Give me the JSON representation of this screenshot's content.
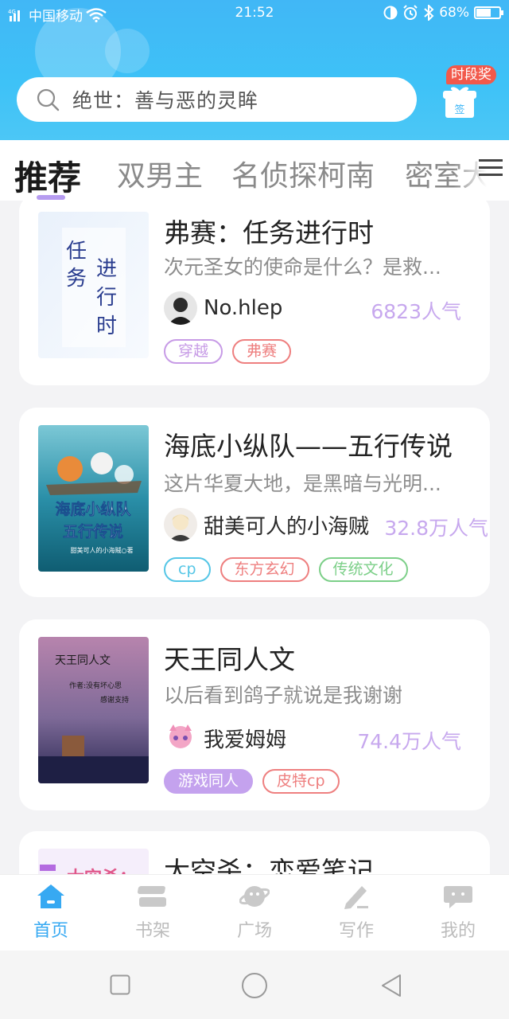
{
  "status_bar": {
    "carrier": "中国移动",
    "time": "21:52",
    "battery": "68%",
    "battery_level": 0.68
  },
  "search": {
    "placeholder": "绝世：善与恶的灵眸"
  },
  "gift": {
    "badge": "时段奖",
    "box_label": "签"
  },
  "tabs": [
    {
      "label": "推荐",
      "active": true
    },
    {
      "label": "双男主",
      "active": false
    },
    {
      "label": "名侦探柯南",
      "active": false
    },
    {
      "label": "密室大",
      "active": false
    }
  ],
  "books": [
    {
      "title": "弗赛：任务进行时",
      "description": "次元圣女的使命是什么？是救...",
      "author": "No.hlep",
      "popularity": "6823人气",
      "tags": [
        {
          "label": "穿越",
          "color": "#c79be6"
        },
        {
          "label": "弗赛",
          "color": "#ee7f7f"
        }
      ],
      "cover_text": [
        "任",
        "务",
        "进",
        "行",
        "时"
      ]
    },
    {
      "title": "海底小纵队——五行传说",
      "description": "这片华夏大地，是黑暗与光明...",
      "author": "甜美可人的小海贼",
      "popularity": "32.8万人气",
      "tags": [
        {
          "label": "cp",
          "color": "#55c6e6"
        },
        {
          "label": "东方玄幻",
          "color": "#ee7f7f"
        },
        {
          "label": "传统文化",
          "color": "#7ccf88"
        }
      ],
      "cover_text": [
        "海底小纵队",
        "五行传说",
        "甜美可人的小海贼○著"
      ]
    },
    {
      "title": "天王同人文",
      "description": "以后看到鸽子就说是我谢谢",
      "author": "我爱姆姆",
      "popularity": "74.4万人气",
      "tags": [
        {
          "label": "游戏同人",
          "color": "#c4a2ee",
          "filled": true
        },
        {
          "label": "皮特cp",
          "color": "#ee7f7f"
        }
      ],
      "cover_text": [
        "天王同人文",
        "作者:没有坏心思",
        "感谢支持"
      ]
    },
    {
      "title": "太空杀：恋爱笔记",
      "cover_text": [
        "太空杀："
      ]
    }
  ],
  "bottom_nav": [
    {
      "label": "首页",
      "icon": "home-icon",
      "active": true
    },
    {
      "label": "书架",
      "icon": "bookshelf-icon",
      "active": false
    },
    {
      "label": "广场",
      "icon": "planet-icon",
      "active": false
    },
    {
      "label": "写作",
      "icon": "pen-icon",
      "active": false
    },
    {
      "label": "我的",
      "icon": "chat-bubble-icon",
      "active": false
    }
  ],
  "colors": {
    "header_blue": "#41b7f6",
    "accent_purple": "#b69cf0",
    "popularity_purple": "#c7a8ee",
    "nav_active": "#37a9f2"
  }
}
